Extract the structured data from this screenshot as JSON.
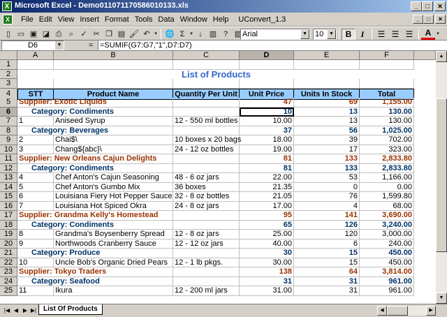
{
  "window": {
    "title": "Microsoft Excel - Demo0110711705860​10133.xls",
    "icon": "X"
  },
  "menu": {
    "items": [
      "File",
      "Edit",
      "View",
      "Insert",
      "Format",
      "Tools",
      "Data",
      "Window",
      "Help",
      "UConvert_1.3"
    ]
  },
  "toolbar": {
    "font_name": "Arial",
    "font_size": "10",
    "buttons": [
      "new",
      "open",
      "save",
      "permission",
      "print",
      "print-preview",
      "spelling",
      "cut",
      "copy",
      "paste",
      "format-painter",
      "undo",
      "hyperlink",
      "autosum",
      "sort-ascending",
      "chart-wizard",
      "help",
      "insert-picture"
    ]
  },
  "formula_bar": {
    "name_box": "D6",
    "formula": "=SUMIF(G7:G7,\"1\",D7:D7)"
  },
  "columns": [
    "A",
    "B",
    "C",
    "D",
    "E",
    "F"
  ],
  "selected_column": "D",
  "selected_row": "6",
  "sheet": {
    "title": "List of Products",
    "headers": [
      "STT",
      "Product Name",
      "Quantity Per Unit",
      "Unit Price",
      "Units In Stock",
      "Total"
    ],
    "rows": [
      {
        "n": "1",
        "type": "blank"
      },
      {
        "n": "2",
        "type": "title"
      },
      {
        "n": "3",
        "type": "blank"
      },
      {
        "n": "4",
        "type": "header"
      },
      {
        "n": "5",
        "type": "supplier",
        "label": "Supplier: Exotic Liquids",
        "d": "47",
        "e": "69",
        "f": "1,155.00"
      },
      {
        "n": "6",
        "type": "category",
        "label": "Category: Condiments",
        "d": "10",
        "e": "13",
        "f": "130.00"
      },
      {
        "n": "7",
        "type": "item",
        "a": "1",
        "b": "Aniseed Syrup",
        "c": "12 - 550 ml bottles",
        "d": "10.00",
        "e": "13",
        "f": "130.00"
      },
      {
        "n": "8",
        "type": "category",
        "label": "Category: Beverages",
        "d": "37",
        "e": "56",
        "f": "1,025.00"
      },
      {
        "n": "9",
        "type": "item",
        "a": "2",
        "b": "Chai$\\",
        "c": "10 boxes x 20 bags",
        "d": "18.00",
        "e": "39",
        "f": "702.00"
      },
      {
        "n": "10",
        "type": "item",
        "a": "3",
        "b": "Chang${abc}\\",
        "c": "24 - 12 oz bottles",
        "d": "19.00",
        "e": "17",
        "f": "323.00"
      },
      {
        "n": "11",
        "type": "supplier",
        "label": "Supplier: New Orleans Cajun Delights",
        "d": "81",
        "e": "133",
        "f": "2,833.80"
      },
      {
        "n": "12",
        "type": "category",
        "label": "Category: Condiments",
        "d": "81",
        "e": "133",
        "f": "2,833.80"
      },
      {
        "n": "13",
        "type": "item",
        "a": "4",
        "b": "Chef Anton's Cajun Seasoning",
        "c": "48 - 6 oz jars",
        "d": "22.00",
        "e": "53",
        "f": "1,166.00"
      },
      {
        "n": "14",
        "type": "item",
        "a": "5",
        "b": "Chef Anton's Gumbo Mix",
        "c": "36 boxes",
        "d": "21.35",
        "e": "0",
        "f": "0.00"
      },
      {
        "n": "15",
        "type": "item",
        "a": "6",
        "b": "Louisiana Fiery Hot Pepper Sauce",
        "c": "32 - 8 oz bottles",
        "d": "21.05",
        "e": "76",
        "f": "1,599.80"
      },
      {
        "n": "16",
        "type": "item",
        "a": "7",
        "b": "Louisiana Hot Spiced Okra",
        "c": "24 - 8 oz jars",
        "d": "17.00",
        "e": "4",
        "f": "68.00"
      },
      {
        "n": "17",
        "type": "supplier",
        "label": "Supplier: Grandma Kelly's Homestead",
        "d": "95",
        "e": "141",
        "f": "3,690.00"
      },
      {
        "n": "18",
        "type": "category",
        "label": "Category: Condiments",
        "d": "65",
        "e": "126",
        "f": "3,240.00"
      },
      {
        "n": "19",
        "type": "item",
        "a": "8",
        "b": "Grandma's Boysenberry Spread",
        "c": "12 - 8 oz jars",
        "d": "25.00",
        "e": "120",
        "f": "3,000.00"
      },
      {
        "n": "20",
        "type": "item",
        "a": "9",
        "b": "Northwoods Cranberry Sauce",
        "c": "12 - 12 oz jars",
        "d": "40.00",
        "e": "6",
        "f": "240.00"
      },
      {
        "n": "21",
        "type": "category",
        "label": "Category: Produce",
        "d": "30",
        "e": "15",
        "f": "450.00"
      },
      {
        "n": "22",
        "type": "item",
        "a": "10",
        "b": "Uncle Bob's Organic Dried Pears",
        "c": "12 - 1 lb pkgs.",
        "d": "30.00",
        "e": "15",
        "f": "450.00"
      },
      {
        "n": "23",
        "type": "supplier",
        "label": "Supplier: Tokyo Traders",
        "d": "138",
        "e": "64",
        "f": "3,814.00"
      },
      {
        "n": "24",
        "type": "category",
        "label": "Category: Seafood",
        "d": "31",
        "e": "31",
        "f": "961.00"
      },
      {
        "n": "25",
        "type": "item",
        "a": "11",
        "b": "Ikura",
        "c": "12 - 200 ml jars",
        "d": "31.00",
        "e": "31",
        "f": "961.00"
      }
    ]
  },
  "tabs": {
    "active": "List Of Products"
  },
  "colors": {
    "header_fill": "#99ccff",
    "supplier_text": "#993300",
    "category_text": "#003366",
    "title_text": "#3366cc"
  }
}
